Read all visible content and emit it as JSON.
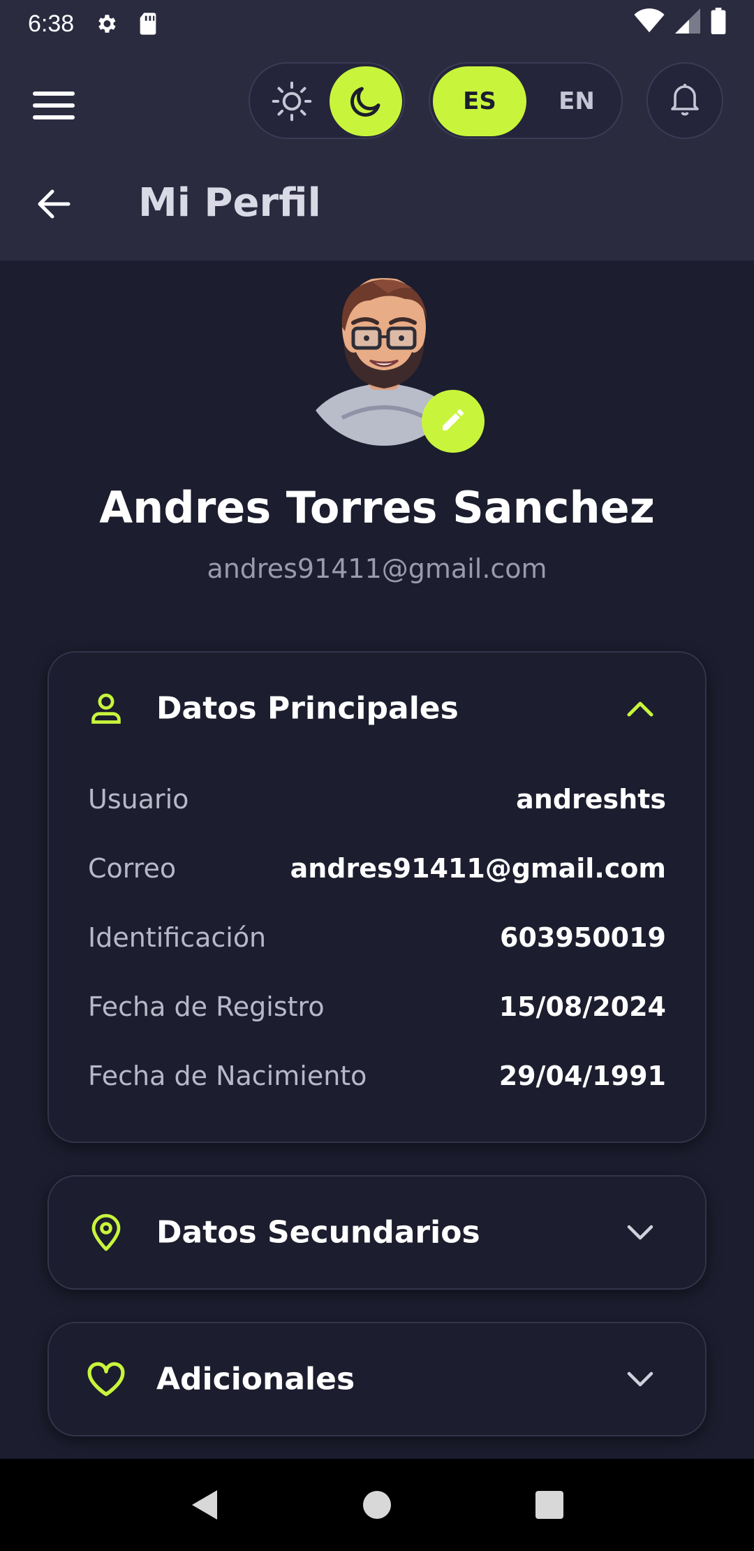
{
  "status_bar": {
    "time": "6:38",
    "icons": [
      "settings-icon",
      "sd-card-icon",
      "wifi-icon",
      "signal-icon",
      "battery-icon"
    ]
  },
  "header": {
    "menu_icon": "hamburger-menu-icon",
    "theme_toggle": {
      "options": [
        "light",
        "dark"
      ],
      "selected": "dark"
    },
    "language_toggle": {
      "options": [
        "ES",
        "EN"
      ],
      "selected": "ES"
    },
    "notifications_icon": "bell-icon",
    "back_icon": "arrow-left-icon",
    "title": "Mi Perfil"
  },
  "profile": {
    "name": "Andres Torres Sanchez",
    "email": "andres91411@gmail.com",
    "edit_icon": "pencil-icon"
  },
  "sections": [
    {
      "title": "Datos Principales",
      "icon": "person-icon",
      "expanded": true,
      "rows": [
        {
          "label": "Usuario",
          "value": "andreshts"
        },
        {
          "label": "Correo",
          "value": "andres91411@gmail.com"
        },
        {
          "label": "Identificación",
          "value": "603950019"
        },
        {
          "label": "Fecha de Registro",
          "value": "15/08/2024"
        },
        {
          "label": "Fecha de Nacimiento",
          "value": "29/04/1991"
        }
      ]
    },
    {
      "title": "Datos Secundarios",
      "icon": "location-pin-icon",
      "expanded": false
    },
    {
      "title": "Adicionales",
      "icon": "heart-icon",
      "expanded": false
    }
  ],
  "colors": {
    "accent": "#c8f53c",
    "background": "#1c1d2e",
    "header_bg": "#2a2b3f",
    "muted_text": "#9a9bab"
  }
}
